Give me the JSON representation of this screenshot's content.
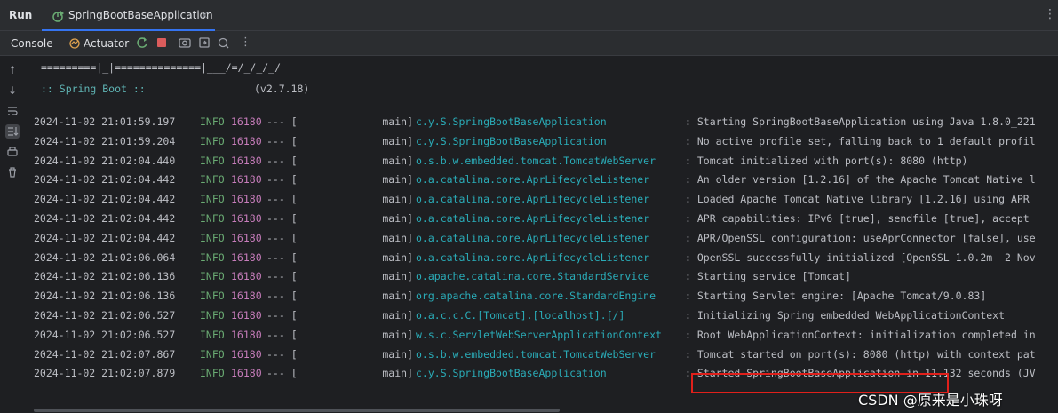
{
  "header": {
    "run_label": "Run",
    "tab_label": "SpringBootBaseApplication",
    "tab_close": "×",
    "more": "⋮"
  },
  "toolbar": {
    "console": "Console",
    "actuator": "Actuator",
    "more": "⋮"
  },
  "banner": {
    "art_line": "=========|_|==============|___/=/_/_/_/",
    "spring_label": ":: Spring Boot ::",
    "version": "(v2.7.18)"
  },
  "logs": [
    {
      "date": "2024-11-02 21:01:59.197",
      "level": "INFO",
      "pid": "16180",
      "sep": "--- [",
      "thread": "main]",
      "logger": "c.y.S.SpringBootBaseApplication",
      "msg": ": Starting SpringBootBaseApplication using Java 1.8.0_221"
    },
    {
      "date": "2024-11-02 21:01:59.204",
      "level": "INFO",
      "pid": "16180",
      "sep": "--- [",
      "thread": "main]",
      "logger": "c.y.S.SpringBootBaseApplication",
      "msg": ": No active profile set, falling back to 1 default profil"
    },
    {
      "date": "2024-11-02 21:02:04.440",
      "level": "INFO",
      "pid": "16180",
      "sep": "--- [",
      "thread": "main]",
      "logger": "o.s.b.w.embedded.tomcat.TomcatWebServer",
      "msg": ": Tomcat initialized with port(s): 8080 (http)"
    },
    {
      "date": "2024-11-02 21:02:04.442",
      "level": "INFO",
      "pid": "16180",
      "sep": "--- [",
      "thread": "main]",
      "logger": "o.a.catalina.core.AprLifecycleListener",
      "msg": ": An older version [1.2.16] of the Apache Tomcat Native l"
    },
    {
      "date": "2024-11-02 21:02:04.442",
      "level": "INFO",
      "pid": "16180",
      "sep": "--- [",
      "thread": "main]",
      "logger": "o.a.catalina.core.AprLifecycleListener",
      "msg": ": Loaded Apache Tomcat Native library [1.2.16] using APR"
    },
    {
      "date": "2024-11-02 21:02:04.442",
      "level": "INFO",
      "pid": "16180",
      "sep": "--- [",
      "thread": "main]",
      "logger": "o.a.catalina.core.AprLifecycleListener",
      "msg": ": APR capabilities: IPv6 [true], sendfile [true], accept"
    },
    {
      "date": "2024-11-02 21:02:04.442",
      "level": "INFO",
      "pid": "16180",
      "sep": "--- [",
      "thread": "main]",
      "logger": "o.a.catalina.core.AprLifecycleListener",
      "msg": ": APR/OpenSSL configuration: useAprConnector [false], use"
    },
    {
      "date": "2024-11-02 21:02:06.064",
      "level": "INFO",
      "pid": "16180",
      "sep": "--- [",
      "thread": "main]",
      "logger": "o.a.catalina.core.AprLifecycleListener",
      "msg": ": OpenSSL successfully initialized [OpenSSL 1.0.2m  2 Nov"
    },
    {
      "date": "2024-11-02 21:02:06.136",
      "level": "INFO",
      "pid": "16180",
      "sep": "--- [",
      "thread": "main]",
      "logger": "o.apache.catalina.core.StandardService",
      "msg": ": Starting service [Tomcat]"
    },
    {
      "date": "2024-11-02 21:02:06.136",
      "level": "INFO",
      "pid": "16180",
      "sep": "--- [",
      "thread": "main]",
      "logger": "org.apache.catalina.core.StandardEngine",
      "msg": ": Starting Servlet engine: [Apache Tomcat/9.0.83]"
    },
    {
      "date": "2024-11-02 21:02:06.527",
      "level": "INFO",
      "pid": "16180",
      "sep": "--- [",
      "thread": "main]",
      "logger": "o.a.c.c.C.[Tomcat].[localhost].[/]",
      "msg": ": Initializing Spring embedded WebApplicationContext"
    },
    {
      "date": "2024-11-02 21:02:06.527",
      "level": "INFO",
      "pid": "16180",
      "sep": "--- [",
      "thread": "main]",
      "logger": "w.s.c.ServletWebServerApplicationContext",
      "msg": ": Root WebApplicationContext: initialization completed in"
    },
    {
      "date": "2024-11-02 21:02:07.867",
      "level": "INFO",
      "pid": "16180",
      "sep": "--- [",
      "thread": "main]",
      "logger": "o.s.b.w.embedded.tomcat.TomcatWebServer",
      "msg": ": Tomcat started on port(s): 8080 (http) with context pat"
    },
    {
      "date": "2024-11-02 21:02:07.879",
      "level": "INFO",
      "pid": "16180",
      "sep": "--- [",
      "thread": "main]",
      "logger": "c.y.S.SpringBootBaseApplication",
      "msg": ": Started SpringBootBaseApplication in 11.132 seconds (JV"
    }
  ],
  "watermark": "CSDN @原来是小珠呀",
  "colors": {
    "background": "#1e1f22",
    "panel": "#2b2d30",
    "info": "#6aab73",
    "pid": "#c77dbb",
    "logger": "#2aacb8",
    "highlight": "#e0201b",
    "accent": "#3574f0"
  }
}
